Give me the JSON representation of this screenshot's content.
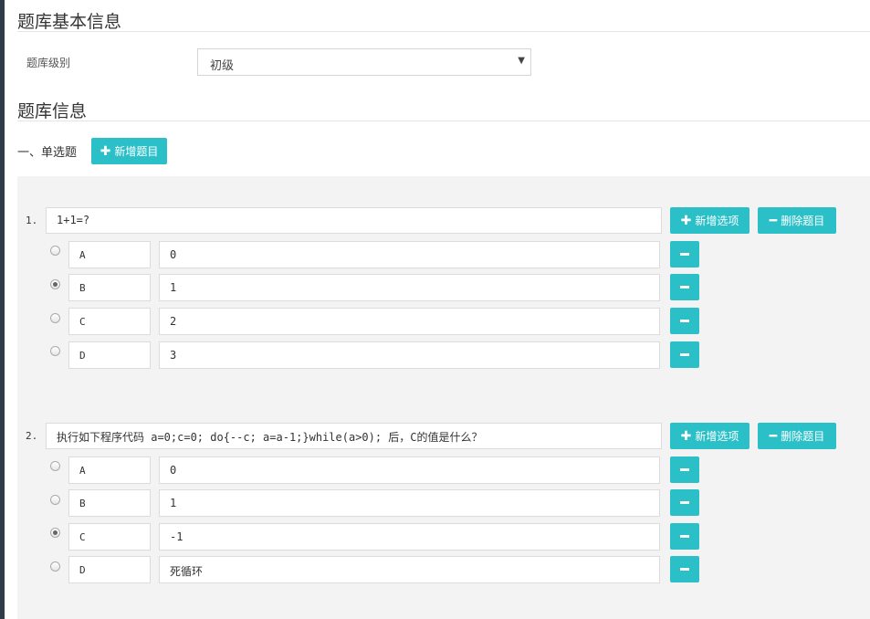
{
  "basic_info": {
    "title": "题库基本信息",
    "level_label": "题库级别",
    "level_value": "初级"
  },
  "bank_info": {
    "title": "题库信息"
  },
  "single_choice": {
    "label": "一、单选题",
    "add_question_label": "新增题目",
    "add_option_label": "新增选项",
    "delete_question_label": "删除题目",
    "questions": [
      {
        "number": "1.",
        "text": "1+1=?",
        "options": [
          {
            "letter": "A",
            "value": "0",
            "selected": false
          },
          {
            "letter": "B",
            "value": "1",
            "selected": true
          },
          {
            "letter": "C",
            "value": "2",
            "selected": false
          },
          {
            "letter": "D",
            "value": "3",
            "selected": false
          }
        ]
      },
      {
        "number": "2.",
        "text": "执行如下程序代码   a=0;c=0;  do{--c; a=a-1;}while(a>0); 后，C的值是什么？",
        "options": [
          {
            "letter": "A",
            "value": "0",
            "selected": false
          },
          {
            "letter": "B",
            "value": "1",
            "selected": false
          },
          {
            "letter": "C",
            "value": "-1",
            "selected": true
          },
          {
            "letter": "D",
            "value": "死循环",
            "selected": false
          }
        ]
      }
    ]
  },
  "colors": {
    "accent": "#2bc0c8",
    "panel_bg": "#f3f3f3",
    "sidebar": "#2f3b47"
  },
  "icons": {
    "plus": "plus-icon",
    "minus": "minus-icon",
    "dropdown": "caret-down-icon"
  }
}
